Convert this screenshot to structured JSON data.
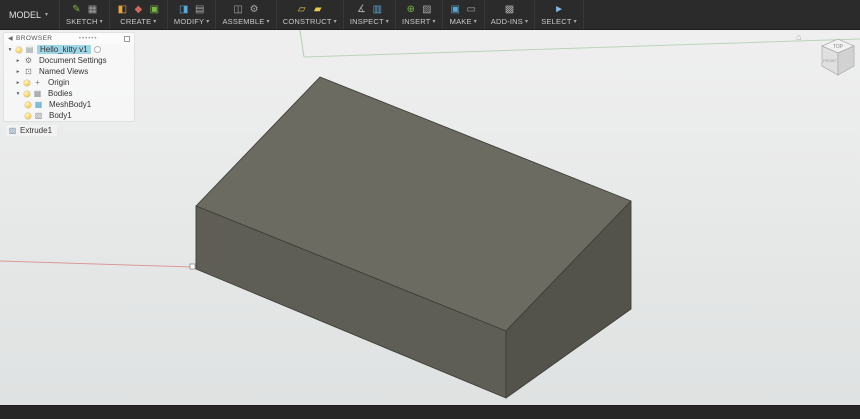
{
  "toolbar": {
    "workspace": "MODEL",
    "groups": [
      {
        "label": "SKETCH"
      },
      {
        "label": "CREATE"
      },
      {
        "label": "MODIFY"
      },
      {
        "label": "ASSEMBLE"
      },
      {
        "label": "CONSTRUCT"
      },
      {
        "label": "INSPECT"
      },
      {
        "label": "INSERT"
      },
      {
        "label": "MAKE"
      },
      {
        "label": "ADD-INS"
      },
      {
        "label": "SELECT"
      }
    ]
  },
  "browser": {
    "header": "BROWSER",
    "items": [
      {
        "label": "Hello_kitty v1",
        "selected": true
      },
      {
        "label": "Document Settings"
      },
      {
        "label": "Named Views"
      },
      {
        "label": "Origin"
      },
      {
        "label": "Bodies"
      },
      {
        "label": "MeshBody1"
      },
      {
        "label": "Body1"
      }
    ]
  },
  "timeline": {
    "last_feature": "Extrude1"
  },
  "viewcube": {
    "top": "TOP",
    "front": "FRONT"
  },
  "colors": {
    "toolbar_bg": "#2b2b2b",
    "selection_highlight": "#9fd6e6",
    "box_top": "#6b6b62",
    "box_left": "#5e5e56",
    "box_right": "#53534c",
    "axis_red": "#dc8f8f",
    "axis_green": "#a5c8a5"
  }
}
